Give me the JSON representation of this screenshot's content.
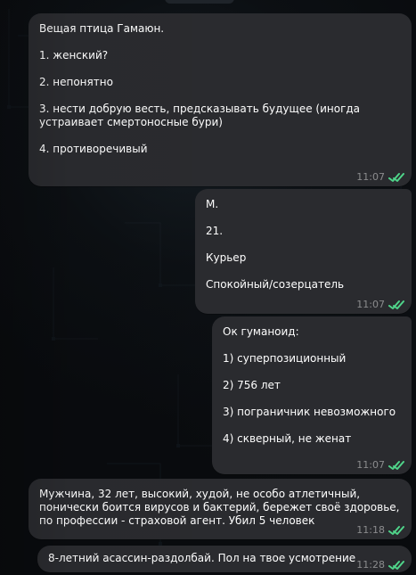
{
  "chat": {
    "messages": [
      {
        "lines": [
          "Вещая птица Гамаюн.",
          "",
          "1. женский?",
          "",
          "2. непонятно",
          "",
          "3. нести добрую весть, предсказывать будущее (иногда",
          "устраивает смертоносные бури)",
          "",
          "4. противоречивый"
        ],
        "time": "11:07"
      },
      {
        "lines": [
          "М.",
          "",
          "21.",
          "",
          "Курьер",
          "",
          "Спокойный/созерцатель"
        ],
        "time": "11:07"
      },
      {
        "lines": [
          "Ок гуманоид:",
          "",
          "1) суперпозиционный",
          "",
          "2) 756 лет",
          "",
          "3) пограничник невозможного",
          "",
          "4) скверный, не женат"
        ],
        "time": "11:07"
      },
      {
        "lines": [
          "Мужчина, 32 лет, высокий, худой, не особо атлетичный,",
          "понически боится вирусов и бактерий, бережет своё здоровье,",
          "по профессии - страховой агент. Убил 5 человек"
        ],
        "time": "11:18"
      },
      {
        "lines": [
          "8-летний асассин-раздолбай. Пол на твое усмотрение"
        ],
        "time": "11:28"
      }
    ]
  },
  "colors": {
    "bubble": "#2a2b2f",
    "check": "#4fd58a",
    "time": "#8d9096"
  },
  "icons": {
    "read_receipt": "double-check-icon"
  }
}
